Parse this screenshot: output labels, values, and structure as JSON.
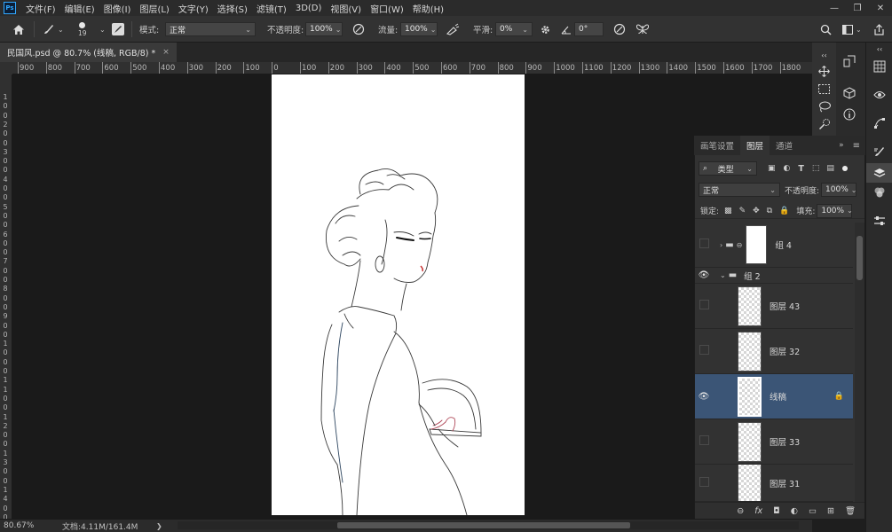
{
  "menubar": {
    "app_icon": "Ps",
    "items": [
      "文件(F)",
      "编辑(E)",
      "图像(I)",
      "图层(L)",
      "文字(Y)",
      "选择(S)",
      "滤镜(T)",
      "3D(D)",
      "视图(V)",
      "窗口(W)",
      "帮助(H)"
    ],
    "window_controls": [
      "—",
      "❐",
      "✕"
    ]
  },
  "options": {
    "brush_size": "19",
    "mode_label": "模式:",
    "mode_value": "正常",
    "opacity_label": "不透明度:",
    "opacity_value": "100%",
    "flow_label": "流量:",
    "flow_value": "100%",
    "smoothing_label": "平滑:",
    "smoothing_value": "0%",
    "angle_value": "0°"
  },
  "document": {
    "tab_title": "民国风.psd @ 80.7% (线稿, RGB/8) *",
    "close": "×"
  },
  "rulers": {
    "h_labels": [
      "900",
      "800",
      "700",
      "600",
      "500",
      "400",
      "300",
      "200",
      "100",
      "0",
      "100",
      "200",
      "300",
      "400",
      "500",
      "600",
      "700",
      "800",
      "900",
      "1000",
      "1100",
      "1200",
      "1300",
      "1400",
      "1500",
      "1600",
      "1700",
      "1800"
    ],
    "v_labels": [
      "1",
      "0",
      "0",
      "2",
      "0",
      "0",
      "3",
      "0",
      "0",
      "4",
      "0",
      "0",
      "5",
      "0",
      "0",
      "6",
      "0",
      "0",
      "7",
      "0",
      "0",
      "8",
      "0",
      "0",
      "9",
      "0",
      "0",
      "1",
      "0",
      "0",
      "0",
      "1",
      "1",
      "0",
      "0",
      "1",
      "2",
      "0",
      "0",
      "1",
      "3",
      "0",
      "0",
      "1",
      "4",
      "0",
      "0"
    ]
  },
  "status": {
    "zoom": "80.67%",
    "doc_info": "文档:4.11M/161.4M",
    "arrow": "❯"
  },
  "layers_panel": {
    "tabs": [
      "画笔设置",
      "图层",
      "通道"
    ],
    "active_tab": "图层",
    "filter_label": "类型",
    "blend_mode": "正常",
    "opacity_label": "不透明度:",
    "opacity_value": "100%",
    "lock_label": "锁定:",
    "fill_label": "填充:",
    "fill_value": "100%",
    "layers": [
      {
        "name": "组 4",
        "visible": false,
        "kind": "group-collapsed"
      },
      {
        "name": "组 2",
        "visible": true,
        "kind": "group-expanded"
      },
      {
        "name": "图层 43",
        "visible": false,
        "kind": "layer"
      },
      {
        "name": "图层 32",
        "visible": false,
        "kind": "layer"
      },
      {
        "name": "线稿",
        "visible": true,
        "kind": "layer",
        "selected": true,
        "locked": true
      },
      {
        "name": "图层 33",
        "visible": false,
        "kind": "layer"
      },
      {
        "name": "图层 31",
        "visible": false,
        "kind": "layer"
      }
    ],
    "footer_icons": [
      "link-icon",
      "fx-icon",
      "mask-icon",
      "adjustment-icon",
      "folder-icon",
      "new-layer-icon",
      "trash-icon"
    ],
    "footer_labels": [
      "⊖",
      "fx",
      "◘",
      "◐",
      "▭",
      "⊞",
      "🗑"
    ]
  }
}
